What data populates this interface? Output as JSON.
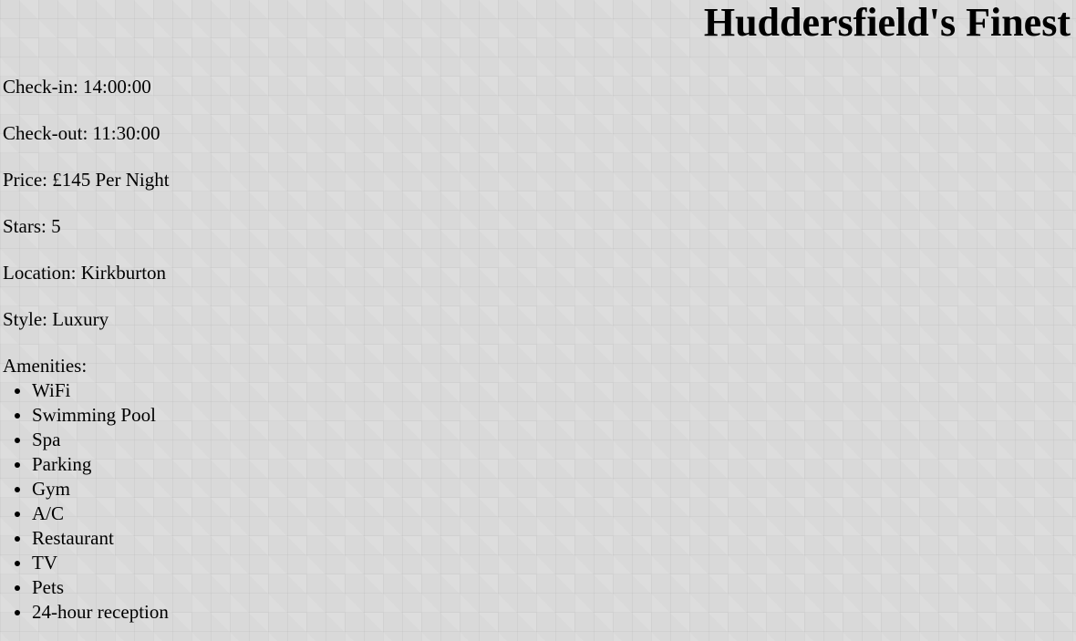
{
  "page": {
    "title": "Huddersfield's Finest"
  },
  "details": [
    {
      "label": "Check-in: 14:00:00"
    },
    {
      "label": "Check-out: 11:30:00"
    },
    {
      "label": "Price: £145 Per Night"
    },
    {
      "label": "Stars: 5"
    },
    {
      "label": "Location: Kirkburton"
    },
    {
      "label": "Style: Luxury"
    }
  ],
  "amenities": {
    "label": "Amenities:",
    "items": [
      "WiFi",
      "Swimming Pool",
      "Spa",
      "Parking",
      "Gym",
      "A/C",
      "Restaurant",
      "TV",
      "Pets",
      "24-hour reception"
    ]
  },
  "colors": {
    "background": "#d9d9d9",
    "text": "#000000"
  }
}
